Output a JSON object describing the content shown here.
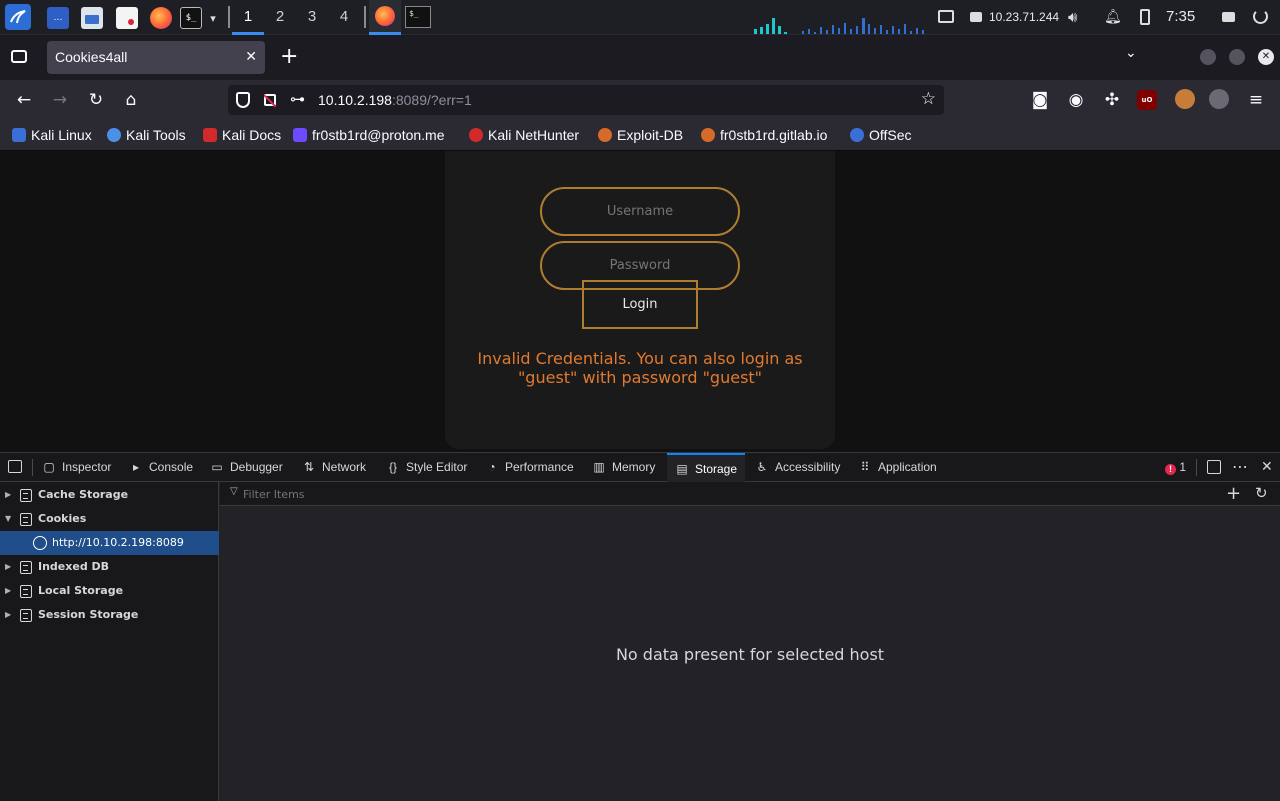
{
  "taskbar": {
    "workspaces": [
      "1",
      "2",
      "3",
      "4"
    ],
    "active_workspace": "1",
    "ip_address": "10.23.71.244",
    "clock": "7:35"
  },
  "browser": {
    "tab_title": "Cookies4all",
    "url_host": "10.10.2.198",
    "url_rest": ":8089/?err=1",
    "bookmarks": [
      {
        "label": "Kali Linux",
        "icon": "kali-dragon-icon"
      },
      {
        "label": "Kali Tools",
        "icon": "kali-tools-icon"
      },
      {
        "label": "Kali Docs",
        "icon": "kali-docs-icon"
      },
      {
        "label": "fr0stb1rd@proton.me",
        "icon": "proton-icon"
      },
      {
        "label": "Kali NetHunter",
        "icon": "nethunter-icon"
      },
      {
        "label": "Exploit-DB",
        "icon": "exploitdb-icon"
      },
      {
        "label": "fr0stb1rd.gitlab.io",
        "icon": "gitlab-icon"
      },
      {
        "label": "OffSec",
        "icon": "offsec-icon"
      }
    ]
  },
  "page": {
    "username_placeholder": "Username",
    "password_placeholder": "Password",
    "login_label": "Login",
    "error_line1": "Invalid Credentials. You can also login as",
    "error_line2": "\"guest\" with password \"guest\""
  },
  "devtools": {
    "tabs": [
      {
        "label": "Inspector",
        "icon": "inspector-icon"
      },
      {
        "label": "Console",
        "icon": "console-icon"
      },
      {
        "label": "Debugger",
        "icon": "debugger-icon"
      },
      {
        "label": "Network",
        "icon": "network-icon"
      },
      {
        "label": "Style Editor",
        "icon": "style-editor-icon"
      },
      {
        "label": "Performance",
        "icon": "performance-icon"
      },
      {
        "label": "Memory",
        "icon": "memory-icon"
      },
      {
        "label": "Storage",
        "icon": "storage-icon"
      },
      {
        "label": "Accessibility",
        "icon": "accessibility-icon"
      },
      {
        "label": "Application",
        "icon": "application-icon"
      }
    ],
    "active_tab": "Storage",
    "error_count": "1",
    "tree": [
      {
        "label": "Cache Storage",
        "expanded": false
      },
      {
        "label": "Cookies",
        "expanded": true
      },
      {
        "label": "http://10.10.2.198:8089",
        "selected": true
      },
      {
        "label": "Indexed DB",
        "expanded": false
      },
      {
        "label": "Local Storage",
        "expanded": false
      },
      {
        "label": "Session Storage",
        "expanded": false
      }
    ],
    "filter_placeholder": "Filter Items",
    "empty_message": "No data present for selected host"
  },
  "colors": {
    "accent": "#0a84ff",
    "selection": "#204e8a",
    "gold_border": "#b07d30",
    "error_text": "#e07a30"
  }
}
